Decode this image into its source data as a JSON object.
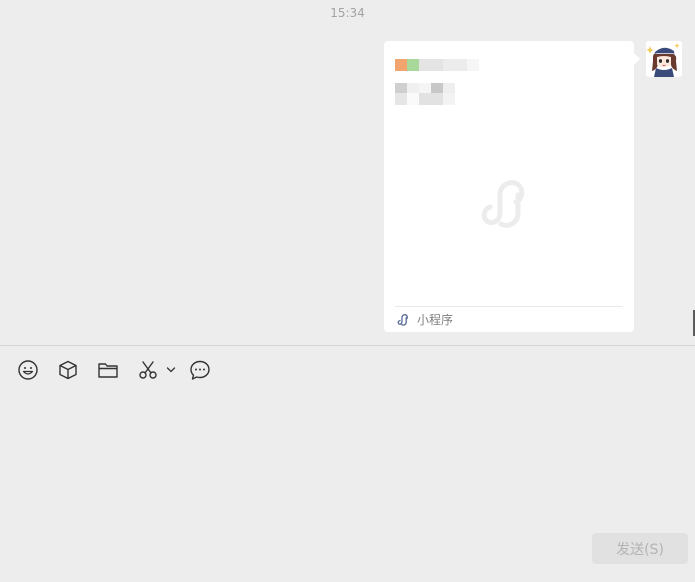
{
  "chat": {
    "timestamp": "15:34"
  },
  "card": {
    "footer_label": "小程序",
    "footer_icon": "mini-program-icon",
    "logo_icon": "mini-program-logo-icon"
  },
  "toolbar": {
    "items": [
      {
        "icon": "emoji-icon"
      },
      {
        "icon": "package-icon"
      },
      {
        "icon": "folder-icon"
      },
      {
        "icon": "scissors-icon"
      },
      {
        "icon": "chevron-down-icon"
      },
      {
        "icon": "chat-bubble-icon"
      }
    ]
  },
  "composer": {
    "send_label": "发送(S)"
  },
  "colors": {
    "background": "#ededed",
    "card": "#ffffff",
    "accent": "#576b95"
  }
}
